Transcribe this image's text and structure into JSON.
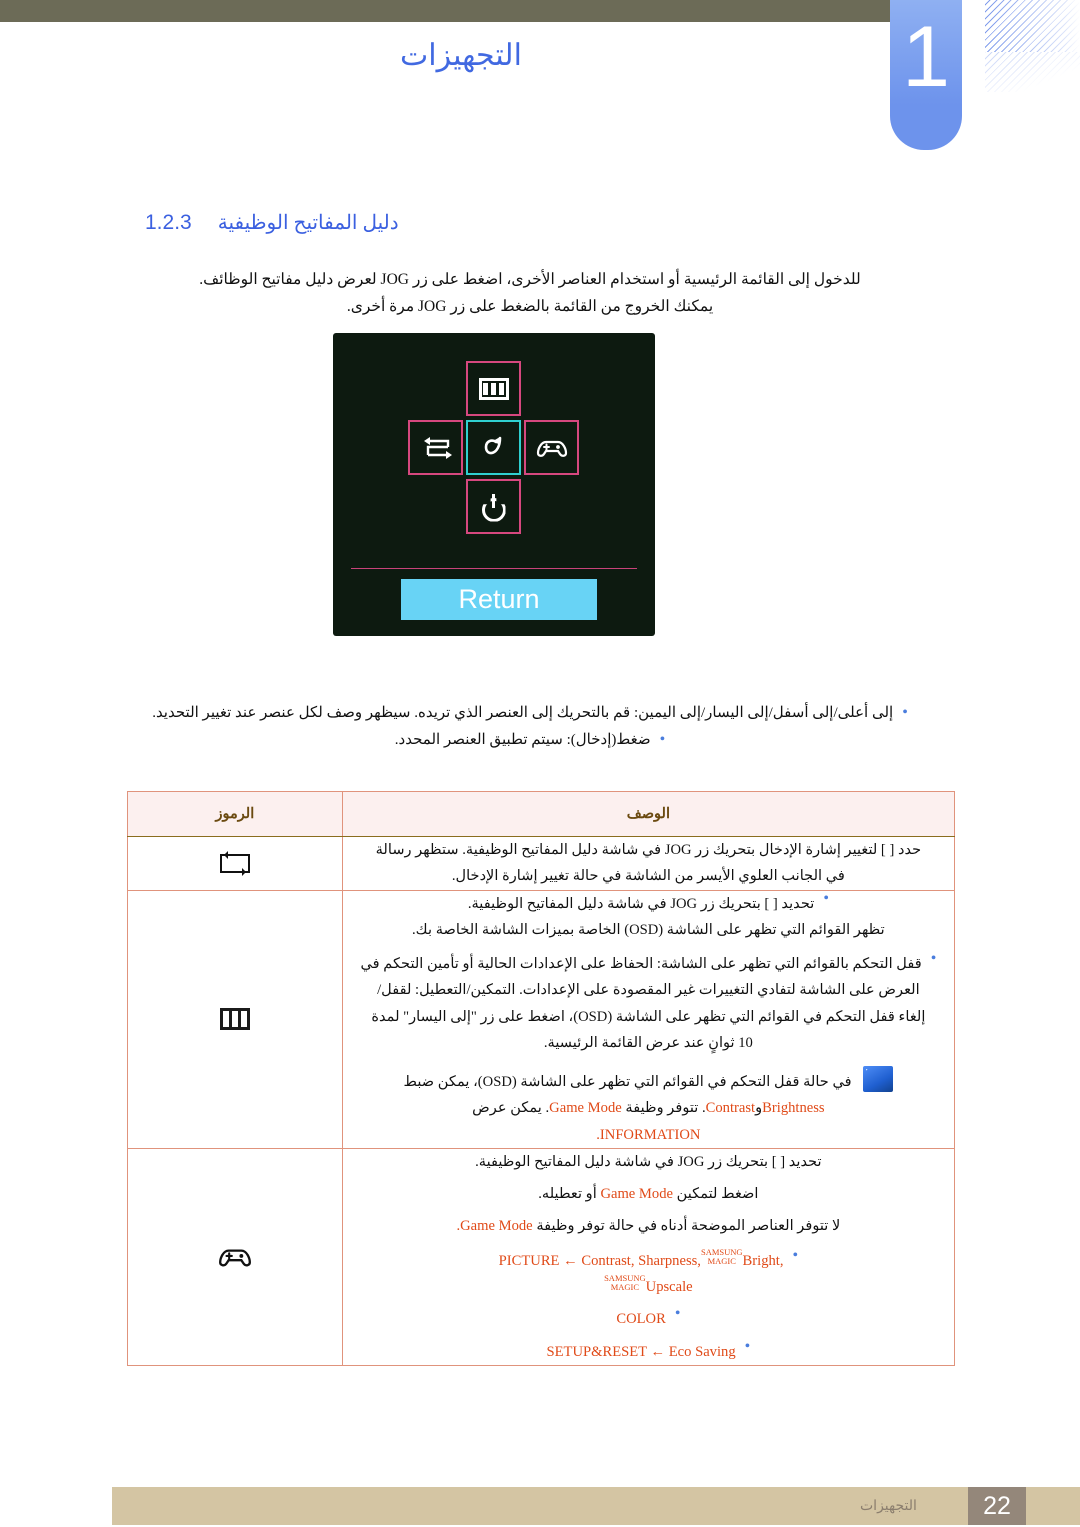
{
  "header": {
    "chapter_number": "1",
    "chapter_title": "التجهيزات"
  },
  "section": {
    "number": "1.2.3",
    "title": "دليل المفاتيح الوظيفية"
  },
  "intro": {
    "line1": "للدخول إلى القائمة الرئيسية أو استخدام العناصر الأخرى، اضغط على زر JOG لعرض دليل مفاتيح الوظائف.",
    "line2": "يمكنك الخروج من القائمة بالضغط على زر JOG مرة أخرى."
  },
  "osd": {
    "keys": {
      "top": "menu-icon",
      "left": "source-icon",
      "center": "return-icon",
      "right": "game-pad-icon",
      "bottom": "power-icon"
    },
    "return_label": "Return",
    "highlight_color": "#2fd0d0",
    "key_border_color": "#d6487f",
    "return_bg": "#68d3f5",
    "panel_bg": "#0d1a10"
  },
  "bullets": [
    "إلى أعلى/إلى أسفل/إلى اليسار/إلى اليمين: قم بالتحريك إلى العنصر الذي تريده. سيظهر وصف لكل عنصر عند تغيير التحديد.",
    "ضغط(إدخال): سيتم تطبيق العنصر المحدد."
  ],
  "table": {
    "headers": {
      "description": "الوصف",
      "symbols": "الرموز"
    },
    "rows": [
      {
        "symbol": "source-icon",
        "lines": [
          "حدد [ ] لتغيير إشارة الإدخال بتحريك زر JOG في شاشة دليل المفاتيح الوظيفية. ستظهر رسالة",
          "في الجانب العلوي الأيسر من الشاشة في حالة تغيير إشارة الإدخال."
        ]
      },
      {
        "symbol": "menu-icon",
        "b1": "تحديد [ ] بتحريك زر JOG في شاشة دليل المفاتيح الوظيفية.",
        "b1_cont": "تظهر القوائم التي تظهر على الشاشة (OSD) الخاصة بميزات الشاشة الخاصة بك.",
        "b2_l1": "قفل التحكم بالقوائم التي تظهر على الشاشة: الحفاظ على الإعدادات الحالية أو تأمين التحكم في",
        "b2_l2": "العرض على الشاشة لتفادي التغييرات غير المقصودة على الإعدادات. التمكين/التعطيل: لقفل/",
        "b2_l3": "إلغاء قفل التحكم في القوائم التي تظهر على الشاشة (OSD)، اضغط على زر \"إلى اليسار\" لمدة",
        "b2_l4": "10 ثوانٍ عند عرض القائمة الرئيسية.",
        "note_l1": "في حالة قفل التحكم في القوائم التي تظهر على الشاشة (OSD)، يمكن ضبط",
        "note_brightness": "Brightness",
        "note_and": "و",
        "note_contrast": "Contrast",
        "note_l2_tail": ". تتوفر وظيفة",
        "note_gamemode": "Game Mode",
        "note_l2_tail2": ". يمكن عرض",
        "note_information": "INFORMATION",
        "note_period": "."
      },
      {
        "symbol": "game-pad-icon",
        "l1": "تحديد [ ] بتحريك زر JOG في شاشة دليل المفاتيح الوظيفية.",
        "l2_pre": "اضغط لتمكين",
        "l2_gamemode": "Game Mode",
        "l2_post": "أو تعطيله.",
        "l3_pre": "لا تتوفر العناصر الموضحة أدناه في حالة توفر وظيفة",
        "l3_gamemode": "Game Mode",
        "l3_post": ".",
        "items": [
          {
            "menu": "PICTURE",
            "arrow": "←",
            "values": "Contrast, Sharpness,",
            "magic_top": "SAMSUNG",
            "magic_bottom": "MAGIC",
            "magic_word": "Bright",
            "values2_magic_top": "SAMSUNG",
            "values2_magic_bottom": "MAGIC",
            "values2": "Upscale"
          },
          {
            "menu": "COLOR",
            "arrow": "",
            "values": ""
          },
          {
            "menu": "SETUP&RESET",
            "arrow": "←",
            "values": "Eco Saving"
          }
        ]
      }
    ]
  },
  "footer": {
    "page_number": "22",
    "chapter_label": "التجهيزات"
  },
  "colors": {
    "header_bar": "#6c6b57",
    "chapter_badge": "#6d93ec",
    "heading_blue": "#3b60e0",
    "accent_orange": "#e04a18",
    "table_border": "#8a6d1e",
    "table_inner": "#e0937c",
    "table_head_bg": "#fcf0ef",
    "footer_band": "#d4c5a3",
    "footer_page": "#94877a"
  }
}
